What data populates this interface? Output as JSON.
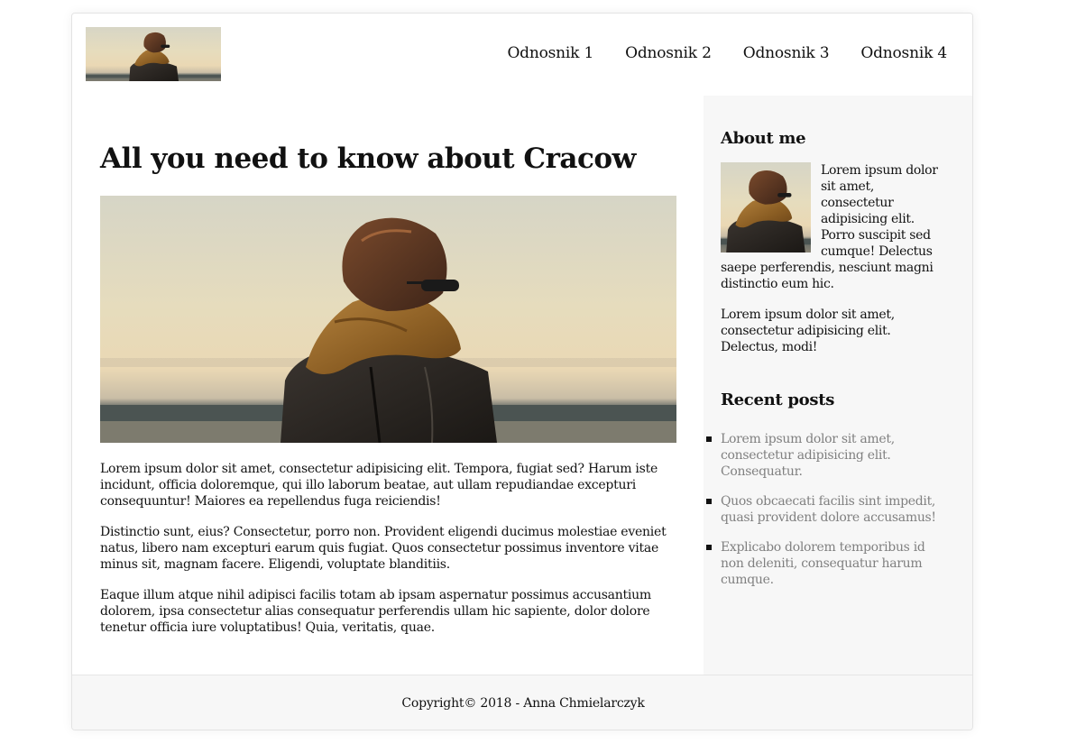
{
  "header": {
    "logo_alt": "logo",
    "nav": [
      {
        "label": "Odnosnik 1"
      },
      {
        "label": "Odnosnik 2"
      },
      {
        "label": "Odnosnik 3"
      },
      {
        "label": "Odnosnik 4"
      }
    ]
  },
  "article": {
    "title": "All you need to know about Cracow",
    "paragraphs": [
      "Lorem ipsum dolor sit amet, consectetur adipisicing elit. Tempora, fugiat sed? Harum iste incidunt, officia doloremque, qui illo laborum beatae, aut ullam repudiandae excepturi consequuntur! Maiores ea repellendus fuga reiciendis!",
      "Distinctio sunt, eius? Consectetur, porro non. Provident eligendi ducimus molestiae eveniet natus, libero nam excepturi earum quis fugiat. Quos consectetur possimus inventore vitae minus sit, magnam facere. Eligendi, voluptate blanditiis.",
      "Eaque illum atque nihil adipisci facilis totam ab ipsam aspernatur possimus accusantium dolorem, ipsa consectetur alias consequatur perferendis ullam hic sapiente, dolor dolore tenetur officia iure voluptatibus! Quia, veritatis, quae."
    ]
  },
  "sidebar": {
    "about_title": "About me",
    "about_text_1": "Lorem ipsum dolor sit amet, consectetur adipisicing elit. Porro suscipit sed cumque! Delectus saepe perferendis, nesciunt magni distinctio eum hic.",
    "about_text_2": "Lorem ipsum dolor sit amet, consectetur adipisicing elit. Delectus, modi!",
    "recent_title": "Recent posts",
    "recent_posts": [
      {
        "label": "Lorem ipsum dolor sit amet, consectetur adipisicing elit. Consequatur."
      },
      {
        "label": "Quos obcaecati facilis sint impedit, quasi provident dolore accusamus!"
      },
      {
        "label": "Explicabo dolorem temporibus id non deleniti, consequatur harum cumque."
      }
    ]
  },
  "footer": {
    "copyright": "Copyright© 2018 - Anna Chmielarczyk"
  },
  "colors": {
    "sidebar_bg": "#f7f7f7",
    "recent_link": "#808080",
    "text": "#111111"
  }
}
